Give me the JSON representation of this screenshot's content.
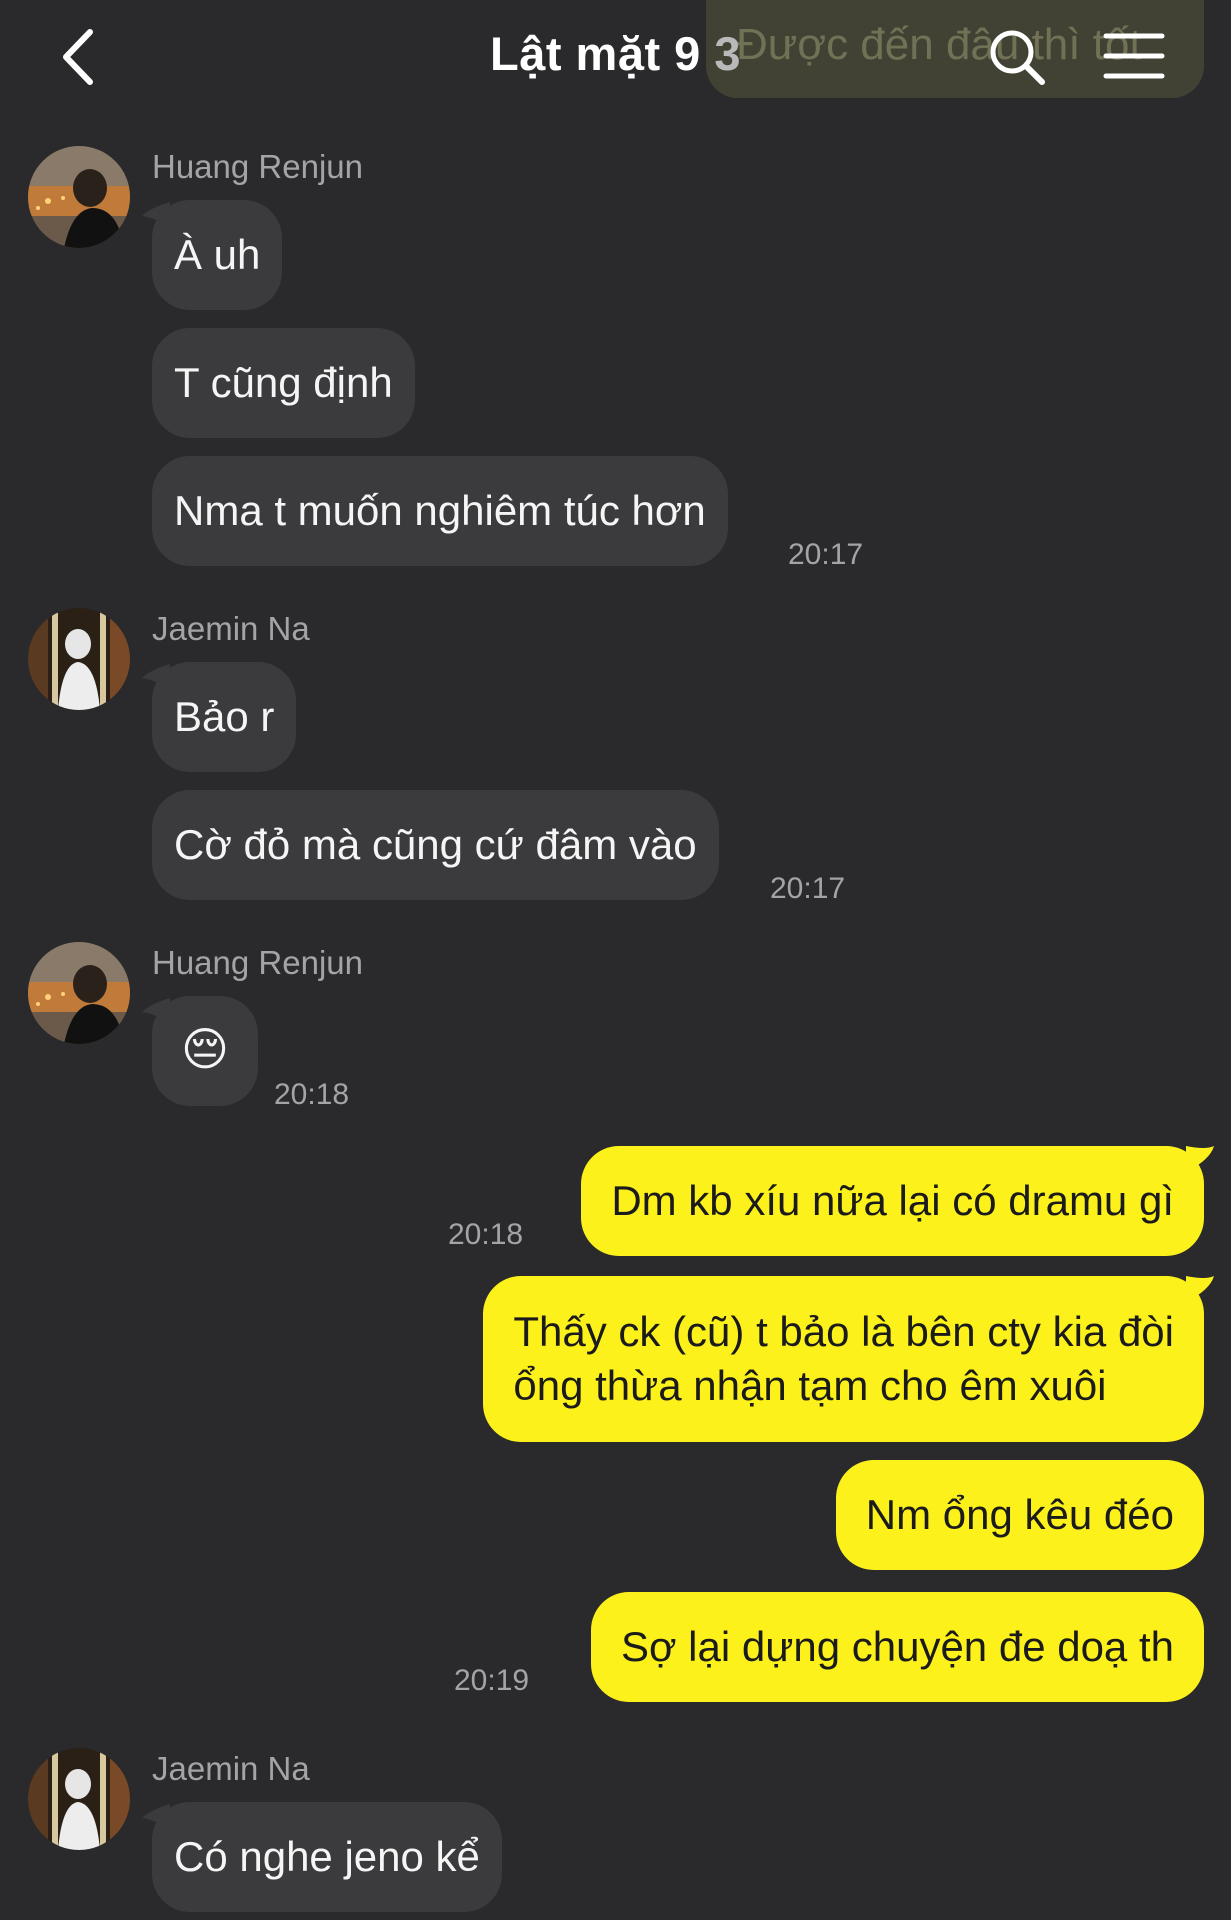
{
  "header": {
    "title": "Lật mặt 9",
    "member_count": "3",
    "pinned_preview": "Được đến đâu thì tốt"
  },
  "icons": {
    "back": "chevron-left-icon",
    "search": "search-icon",
    "menu": "hamburger-menu-icon"
  },
  "colors": {
    "background": "#2a2a2c",
    "incoming_bubble": "#3b3b3e",
    "outgoing_bubble": "#fdf11b"
  },
  "messages": {
    "g1": {
      "sender": "Huang Renjun",
      "m1": "À uh",
      "m2": "T cũng định",
      "m3": "Nma t muốn nghiêm túc hơn",
      "time": "20:17"
    },
    "g2": {
      "sender": "Jaemin Na",
      "m1": "Bảo r",
      "m2": "Cờ đỏ mà cũng cứ đâm vào",
      "time": "20:17"
    },
    "g3": {
      "sender": "Huang Renjun",
      "m1": "😔",
      "time": "20:18"
    },
    "g4": {
      "m1": "Dm kb xíu nữa lại có dramu gì",
      "time": "20:18"
    },
    "g5": {
      "m1_line1": "Thấy ck (cũ) t bảo là bên cty kia đòi",
      "m1_line2": "ổng thừa nhận tạm cho êm xuôi",
      "m2": "Nm ổng kêu đéo",
      "m3": "Sợ lại dựng chuyện đe doạ th",
      "time": "20:19"
    },
    "g6": {
      "sender": "Jaemin Na",
      "m1": "Có nghe jeno kể"
    }
  }
}
